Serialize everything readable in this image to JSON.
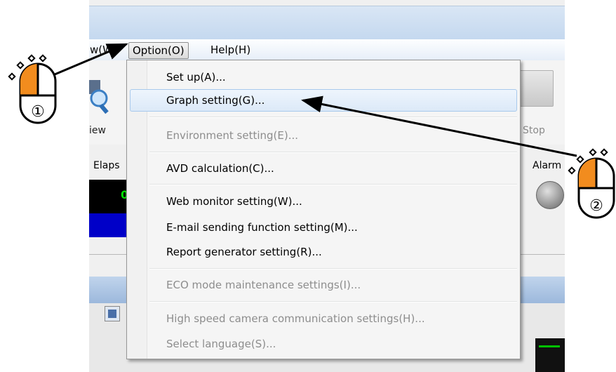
{
  "menubar": {
    "view_label": "w(W)",
    "option_label": "Option(O)",
    "help_label": "Help(H)"
  },
  "toolbar": {
    "view_label": "iew",
    "stop_label": "Stop"
  },
  "panel": {
    "elapsed_label": "Elaps",
    "alarm_label": "Alarm",
    "elapsed_value": "0"
  },
  "option_menu": {
    "items": [
      {
        "label": "Set up(A)...",
        "enabled": true
      },
      {
        "label": "Graph setting(G)...",
        "enabled": true,
        "highlighted": true
      },
      {
        "label": "Environment setting(E)...",
        "enabled": false
      },
      {
        "label": "AVD calculation(C)...",
        "enabled": true
      },
      {
        "label": "Web monitor setting(W)...",
        "enabled": true
      },
      {
        "label": "E-mail sending function setting(M)...",
        "enabled": true
      },
      {
        "label": "Report generator setting(R)...",
        "enabled": true
      },
      {
        "label": "ECO mode maintenance settings(I)...",
        "enabled": false
      },
      {
        "label": "High speed camera communication settings(H)...",
        "enabled": false
      },
      {
        "label": "Select language(S)...",
        "enabled": false
      }
    ]
  },
  "annotations": {
    "step1_symbol": "①",
    "step2_symbol": "②",
    "mouse_button_color": "#f28c1e"
  }
}
